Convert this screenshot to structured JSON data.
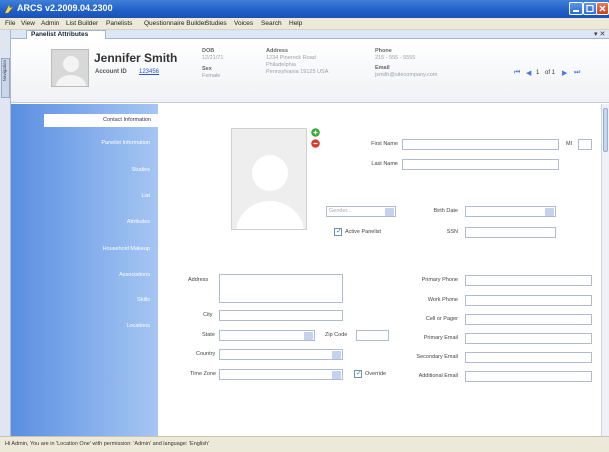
{
  "window": {
    "title": "ARCS v2.2009.04.2300"
  },
  "menu": [
    "File",
    "View",
    "Admin",
    "List Builder",
    "Panelists",
    "Questionnaire Builder",
    "Studies",
    "Voices",
    "Search",
    "Help"
  ],
  "side_strip_label": "Navigation",
  "tab": {
    "label": "Panelist Attributes",
    "controls": "▾ ✕"
  },
  "header": {
    "name": "Jennifer Smith",
    "account_label": "Account ID",
    "account_id": "123456",
    "dob_label": "DOB",
    "dob": "12/21/71",
    "sex_label": "Sex",
    "sex": "Female",
    "address_label": "Address",
    "address_lines": [
      "1234 Pinerock Road",
      "Philadelphia",
      "Pennsylvania  19125  USA"
    ],
    "phone_label": "Phone",
    "phone": "215 - 555 - 5555",
    "email_label": "Email",
    "email": "jsmith@sitecompany.com",
    "record_nav": {
      "first": "⏮",
      "prev": "◀",
      "current": "1",
      "of_label": "of 1",
      "next": "▶",
      "last": "⏭"
    }
  },
  "leftnav": {
    "items": [
      {
        "label": "Contact Information",
        "active": true
      },
      {
        "label": "Panelist Information",
        "active": false
      },
      {
        "label": "Studies",
        "active": false
      },
      {
        "label": "List",
        "active": false
      },
      {
        "label": "Attributes",
        "active": false
      },
      {
        "label": "Household Makeup",
        "active": false
      },
      {
        "label": "Associations",
        "active": false
      },
      {
        "label": "Skills",
        "active": false
      },
      {
        "label": "Locations",
        "active": false
      }
    ]
  },
  "form": {
    "first_name_label": "First Name",
    "mi_label": "MI",
    "last_name_label": "Last Name",
    "gender_placeholder": "Gender...",
    "active_panelist_label": "Active Panelist",
    "active_panelist_checked": true,
    "birth_date_label": "Birth Date",
    "ssn_label": "SSN",
    "address_label": "Address",
    "city_label": "City",
    "state_label": "State",
    "zip_label": "Zip Code",
    "country_label": "Country",
    "timezone_label": "Time Zone",
    "override_label": "Override",
    "override_checked": true,
    "primary_phone_label": "Primary Phone",
    "work_phone_label": "Work Phone",
    "cell_label": "Cell or Pager",
    "primary_email_label": "Primary Email",
    "secondary_email_label": "Secondary Email",
    "additional_email_label": "Additional Email"
  },
  "status": "Hi Admin, You are in 'Location One' with permission: 'Admin' and language: 'English'",
  "colors": {
    "nav_blue": "#5b8ee0",
    "title_blue": "#1f5fc8",
    "add_green": "#3aa83a",
    "remove_red": "#d43c2c"
  }
}
